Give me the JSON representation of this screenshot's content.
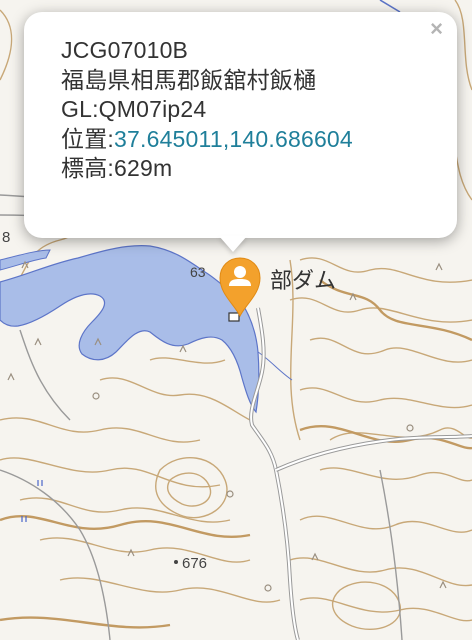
{
  "map": {
    "labels": {
      "dam_name": "部ダム",
      "elev_top": "63",
      "elev_spot": "676",
      "edge_digit": "8"
    },
    "colors": {
      "water": "#a9bde8",
      "road": "#9a9a9a",
      "contour": "#c8a878",
      "index_contour": "#c29a62",
      "background": "#f6f4ef"
    }
  },
  "popup": {
    "close_label": "×",
    "line1": "JCG07010B",
    "line2": "福島県相馬郡飯舘村飯樋",
    "gl_label": "GL:",
    "gl_value": "QM07ip24",
    "position_label": "位置:",
    "position_value": "37.645011,140.686604",
    "elevation_label": "標高:",
    "elevation_value": "629m"
  },
  "marker": {
    "icon": "person-icon",
    "color": "#f3a12c"
  }
}
